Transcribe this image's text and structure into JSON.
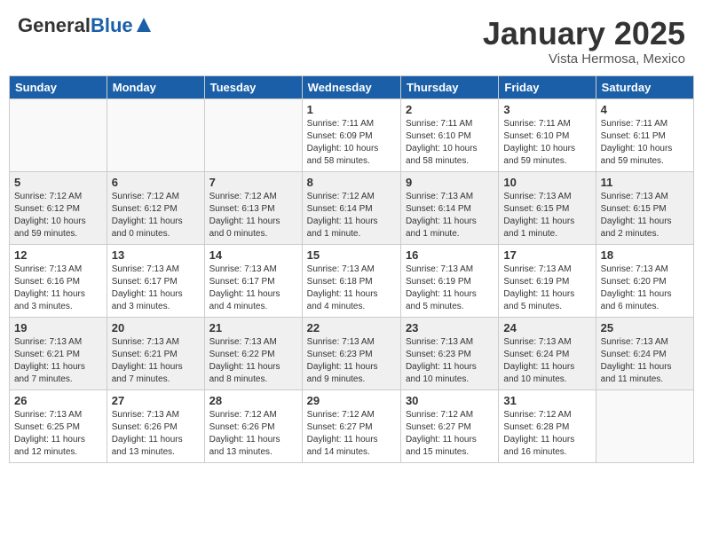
{
  "header": {
    "logo_general": "General",
    "logo_blue": "Blue",
    "title": "January 2025",
    "location": "Vista Hermosa, Mexico"
  },
  "days_of_week": [
    "Sunday",
    "Monday",
    "Tuesday",
    "Wednesday",
    "Thursday",
    "Friday",
    "Saturday"
  ],
  "weeks": [
    [
      {
        "day": "",
        "info": ""
      },
      {
        "day": "",
        "info": ""
      },
      {
        "day": "",
        "info": ""
      },
      {
        "day": "1",
        "info": "Sunrise: 7:11 AM\nSunset: 6:09 PM\nDaylight: 10 hours\nand 58 minutes."
      },
      {
        "day": "2",
        "info": "Sunrise: 7:11 AM\nSunset: 6:10 PM\nDaylight: 10 hours\nand 58 minutes."
      },
      {
        "day": "3",
        "info": "Sunrise: 7:11 AM\nSunset: 6:10 PM\nDaylight: 10 hours\nand 59 minutes."
      },
      {
        "day": "4",
        "info": "Sunrise: 7:11 AM\nSunset: 6:11 PM\nDaylight: 10 hours\nand 59 minutes."
      }
    ],
    [
      {
        "day": "5",
        "info": "Sunrise: 7:12 AM\nSunset: 6:12 PM\nDaylight: 10 hours\nand 59 minutes."
      },
      {
        "day": "6",
        "info": "Sunrise: 7:12 AM\nSunset: 6:12 PM\nDaylight: 11 hours\nand 0 minutes."
      },
      {
        "day": "7",
        "info": "Sunrise: 7:12 AM\nSunset: 6:13 PM\nDaylight: 11 hours\nand 0 minutes."
      },
      {
        "day": "8",
        "info": "Sunrise: 7:12 AM\nSunset: 6:14 PM\nDaylight: 11 hours\nand 1 minute."
      },
      {
        "day": "9",
        "info": "Sunrise: 7:13 AM\nSunset: 6:14 PM\nDaylight: 11 hours\nand 1 minute."
      },
      {
        "day": "10",
        "info": "Sunrise: 7:13 AM\nSunset: 6:15 PM\nDaylight: 11 hours\nand 1 minute."
      },
      {
        "day": "11",
        "info": "Sunrise: 7:13 AM\nSunset: 6:15 PM\nDaylight: 11 hours\nand 2 minutes."
      }
    ],
    [
      {
        "day": "12",
        "info": "Sunrise: 7:13 AM\nSunset: 6:16 PM\nDaylight: 11 hours\nand 3 minutes."
      },
      {
        "day": "13",
        "info": "Sunrise: 7:13 AM\nSunset: 6:17 PM\nDaylight: 11 hours\nand 3 minutes."
      },
      {
        "day": "14",
        "info": "Sunrise: 7:13 AM\nSunset: 6:17 PM\nDaylight: 11 hours\nand 4 minutes."
      },
      {
        "day": "15",
        "info": "Sunrise: 7:13 AM\nSunset: 6:18 PM\nDaylight: 11 hours\nand 4 minutes."
      },
      {
        "day": "16",
        "info": "Sunrise: 7:13 AM\nSunset: 6:19 PM\nDaylight: 11 hours\nand 5 minutes."
      },
      {
        "day": "17",
        "info": "Sunrise: 7:13 AM\nSunset: 6:19 PM\nDaylight: 11 hours\nand 5 minutes."
      },
      {
        "day": "18",
        "info": "Sunrise: 7:13 AM\nSunset: 6:20 PM\nDaylight: 11 hours\nand 6 minutes."
      }
    ],
    [
      {
        "day": "19",
        "info": "Sunrise: 7:13 AM\nSunset: 6:21 PM\nDaylight: 11 hours\nand 7 minutes."
      },
      {
        "day": "20",
        "info": "Sunrise: 7:13 AM\nSunset: 6:21 PM\nDaylight: 11 hours\nand 7 minutes."
      },
      {
        "day": "21",
        "info": "Sunrise: 7:13 AM\nSunset: 6:22 PM\nDaylight: 11 hours\nand 8 minutes."
      },
      {
        "day": "22",
        "info": "Sunrise: 7:13 AM\nSunset: 6:23 PM\nDaylight: 11 hours\nand 9 minutes."
      },
      {
        "day": "23",
        "info": "Sunrise: 7:13 AM\nSunset: 6:23 PM\nDaylight: 11 hours\nand 10 minutes."
      },
      {
        "day": "24",
        "info": "Sunrise: 7:13 AM\nSunset: 6:24 PM\nDaylight: 11 hours\nand 10 minutes."
      },
      {
        "day": "25",
        "info": "Sunrise: 7:13 AM\nSunset: 6:24 PM\nDaylight: 11 hours\nand 11 minutes."
      }
    ],
    [
      {
        "day": "26",
        "info": "Sunrise: 7:13 AM\nSunset: 6:25 PM\nDaylight: 11 hours\nand 12 minutes."
      },
      {
        "day": "27",
        "info": "Sunrise: 7:13 AM\nSunset: 6:26 PM\nDaylight: 11 hours\nand 13 minutes."
      },
      {
        "day": "28",
        "info": "Sunrise: 7:12 AM\nSunset: 6:26 PM\nDaylight: 11 hours\nand 13 minutes."
      },
      {
        "day": "29",
        "info": "Sunrise: 7:12 AM\nSunset: 6:27 PM\nDaylight: 11 hours\nand 14 minutes."
      },
      {
        "day": "30",
        "info": "Sunrise: 7:12 AM\nSunset: 6:27 PM\nDaylight: 11 hours\nand 15 minutes."
      },
      {
        "day": "31",
        "info": "Sunrise: 7:12 AM\nSunset: 6:28 PM\nDaylight: 11 hours\nand 16 minutes."
      },
      {
        "day": "",
        "info": ""
      }
    ]
  ]
}
